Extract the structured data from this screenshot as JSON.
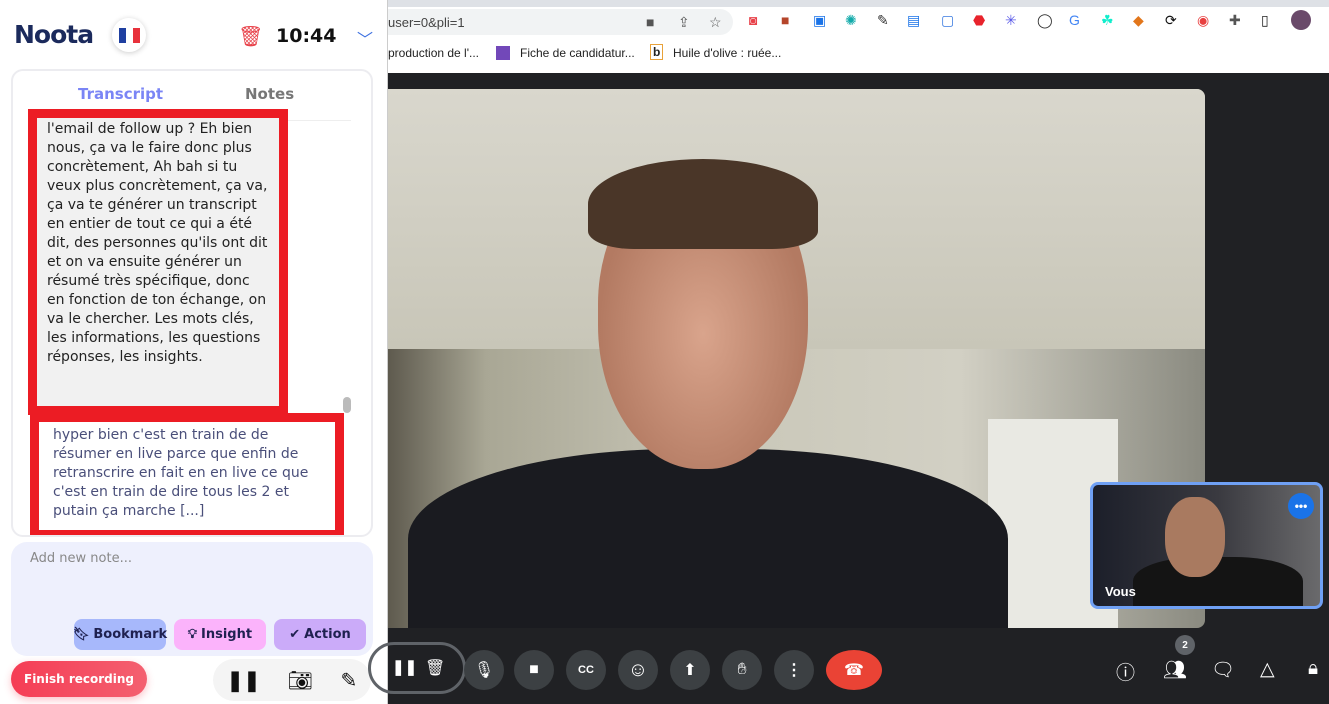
{
  "noota": {
    "logo": "Noota",
    "language": "fr",
    "time": "10:44",
    "tabs": [
      {
        "label": "Transcript",
        "active": true
      },
      {
        "label": "Notes",
        "active": false
      }
    ],
    "transcript": [
      "l'email de follow up ? Eh bien nous, ça va le faire donc plus concrètement, Ah bah si tu veux plus concrètement, ça va, ça va te générer un transcript en entier de tout ce qui a été dit, des personnes qu'ils ont dit et on va ensuite générer un résumé très spécifique, donc en fonction de ton échange, on va le chercher. Les mots clés, les informations, les questions réponses, les insights.",
      "hyper bien c'est en train de de résumer en live parce que enfin de retranscrire en fait en en live ce que c'est en train de dire tous les 2 et putain ça marche [...]"
    ],
    "note_placeholder": "Add new note...",
    "tags": [
      {
        "label": "Bookmark",
        "color": "#a7b8fb"
      },
      {
        "label": "Insight",
        "color": "#fbb3fb"
      },
      {
        "label": "Action",
        "color": "#cbabf9"
      }
    ],
    "finish_label": "Finish recording",
    "highlight_color": "#ec1c24"
  },
  "browser": {
    "url": "user=0&pli=1",
    "bookmarks": [
      "production de l'...",
      "Fiche de candidatur...",
      "Huile d'olive : ruée..."
    ]
  },
  "meet": {
    "self_label": "Vous",
    "participants_count": "2"
  }
}
